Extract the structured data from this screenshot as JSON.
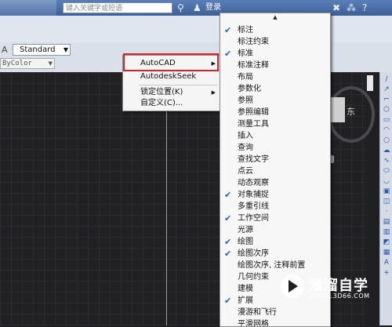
{
  "title_bar": {
    "search_placeholder": "键入关键字或短语",
    "login_label": "登录",
    "help_icon": "question-icon"
  },
  "toolbar": {
    "text_style": "Standard",
    "color_value": "ByColor"
  },
  "context_menu": {
    "items": [
      {
        "label": "AutoCAD",
        "submenu": true
      },
      {
        "label": "AutodeskSeek",
        "submenu": false
      },
      {
        "label": "锁定位置(K)",
        "submenu": true
      },
      {
        "label": "自定义(C)...",
        "submenu": false
      }
    ],
    "highlight_color": "#d8232a"
  },
  "toolbars_menu": {
    "items": [
      {
        "label": "标注",
        "checked": true
      },
      {
        "label": "标注约束",
        "checked": false
      },
      {
        "label": "标准",
        "checked": true
      },
      {
        "label": "标准注释",
        "checked": false
      },
      {
        "label": "布局",
        "checked": false
      },
      {
        "label": "参数化",
        "checked": false
      },
      {
        "label": "参照",
        "checked": false
      },
      {
        "label": "参照编辑",
        "checked": false
      },
      {
        "label": "测量工具",
        "checked": false
      },
      {
        "label": "插入",
        "checked": false
      },
      {
        "label": "查询",
        "checked": false
      },
      {
        "label": "查找文字",
        "checked": false
      },
      {
        "label": "点云",
        "checked": false
      },
      {
        "label": "动态观察",
        "checked": false
      },
      {
        "label": "对象捕捉",
        "checked": true
      },
      {
        "label": "多重引线",
        "checked": false
      },
      {
        "label": "工作空间",
        "checked": true
      },
      {
        "label": "光源",
        "checked": false
      },
      {
        "label": "绘图",
        "checked": true
      },
      {
        "label": "绘图次序",
        "checked": true
      },
      {
        "label": "绘图次序, 注释前置",
        "checked": false
      },
      {
        "label": "几何约束",
        "checked": false
      },
      {
        "label": "建模",
        "checked": false
      },
      {
        "label": "扩展",
        "checked": true
      },
      {
        "label": "漫游和飞行",
        "checked": false
      },
      {
        "label": "平滑网格",
        "checked": false
      }
    ]
  },
  "viewcube": {
    "direction_label": "东"
  },
  "watermark": {
    "title": "溜溜自学",
    "url": "ZIXUE.3D66.COM"
  }
}
